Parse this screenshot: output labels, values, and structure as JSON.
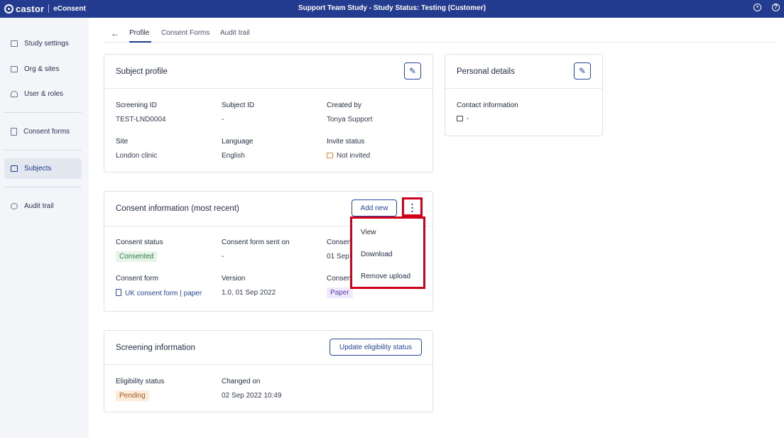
{
  "brand": {
    "logo": "castor",
    "product": "eConsent"
  },
  "header": {
    "title": "Support Team Study  - Study Status: Testing (Customer)",
    "user_icon": "user-circle-icon",
    "help_icon": "help-icon"
  },
  "sidebar": {
    "items": [
      {
        "label": "Study settings",
        "icon": "book-icon"
      },
      {
        "label": "Org & sites",
        "icon": "building-icon"
      },
      {
        "label": "User & roles",
        "icon": "users-icon"
      },
      {
        "label": "Consent forms",
        "icon": "document-icon"
      },
      {
        "label": "Subjects",
        "icon": "subjects-icon",
        "active": true
      },
      {
        "label": "Audit trail",
        "icon": "history-icon"
      }
    ]
  },
  "tabs": {
    "back": "←",
    "items": [
      "Profile",
      "Consent Forms",
      "Audit trail"
    ],
    "active": "Profile"
  },
  "subject_profile": {
    "title": "Subject profile",
    "screening_id_label": "Screening ID",
    "screening_id": "TEST-LND0004",
    "subject_id_label": "Subject ID",
    "subject_id": "-",
    "created_by_label": "Created by",
    "created_by": "Tonya Support",
    "site_label": "Site",
    "site": "London clinic",
    "language_label": "Language",
    "language": "English",
    "invite_status_label": "Invite status",
    "invite_status": "Not invited"
  },
  "personal_details": {
    "title": "Personal details",
    "contact_label": "Contact information",
    "contact_value": "-"
  },
  "consent_info": {
    "title": "Consent information (most recent)",
    "add_new": "Add new",
    "more_icon": "⋮",
    "status_label": "Consent status",
    "status": "Consented",
    "sent_on_label": "Consent form sent on",
    "sent_on": "-",
    "col3_label_top": "Consen",
    "col3_value_top": "01 Sep",
    "form_label": "Consent form",
    "form": "UK consent form | paper",
    "version_label": "Version",
    "version": "1.0, 01 Sep 2022",
    "col3_label_bottom": "Consen",
    "col3_value_bottom": "Paper",
    "menu": [
      "View",
      "Download",
      "Remove upload"
    ]
  },
  "screening_info": {
    "title": "Screening information",
    "update_button": "Update eligibility status",
    "eligibility_label": "Eligibility status",
    "eligibility": "Pending",
    "changed_on_label": "Changed on",
    "changed_on": "02 Sep 2022 10:49"
  },
  "colors": {
    "topbar": "#243c8f",
    "accent": "#2747a3",
    "highlight": "#d0021b",
    "sidebar_bg": "#f3f5f9"
  }
}
